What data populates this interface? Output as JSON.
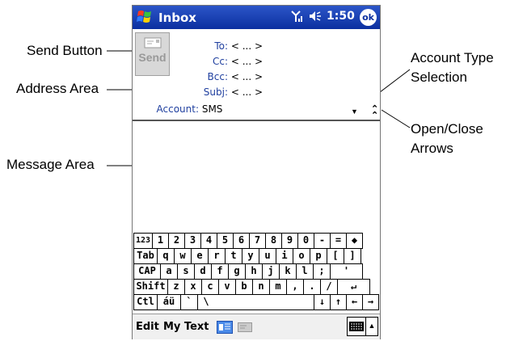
{
  "titlebar": {
    "title": "Inbox",
    "time": "1:50",
    "ok_label": "ok"
  },
  "send_button": {
    "label": "Send"
  },
  "address": {
    "to_label": "To:",
    "to_value": "< ... >",
    "cc_label": "Cc:",
    "cc_value": "< ... >",
    "bcc_label": "Bcc:",
    "bcc_value": "< ... >",
    "subj_label": "Subj:",
    "subj_value": "< ... >",
    "account_label": "Account:",
    "account_value": "SMS"
  },
  "keyboard": {
    "rows": [
      [
        "123",
        "1",
        "2",
        "3",
        "4",
        "5",
        "6",
        "7",
        "8",
        "9",
        "0",
        "-",
        "=",
        "◆"
      ],
      [
        "Tab",
        "q",
        "w",
        "e",
        "r",
        "t",
        "y",
        "u",
        "i",
        "o",
        "p",
        "[",
        "]"
      ],
      [
        "CAP",
        "a",
        "s",
        "d",
        "f",
        "g",
        "h",
        "j",
        "k",
        "l",
        ";",
        "'"
      ],
      [
        "Shift",
        "z",
        "x",
        "c",
        "v",
        "b",
        "n",
        "m",
        ",",
        ".",
        "/",
        "↵"
      ],
      [
        "Ctl",
        "áü",
        "`",
        "\\",
        "",
        "",
        "↓",
        "↑",
        "←",
        "→"
      ]
    ]
  },
  "menubar": {
    "edit_label": "Edit",
    "mytext_label": "My Text"
  },
  "callouts": {
    "send_button": "Send Button",
    "address_area": "Address Area",
    "message_area": "Message Area",
    "account_type_line1": "Account Type",
    "account_type_line2": "Selection",
    "open_close_line1": "Open/Close",
    "open_close_line2": "Arrows"
  },
  "colors": {
    "titlebar": "#0b2fa0",
    "field_label": "#1f3f9f"
  }
}
